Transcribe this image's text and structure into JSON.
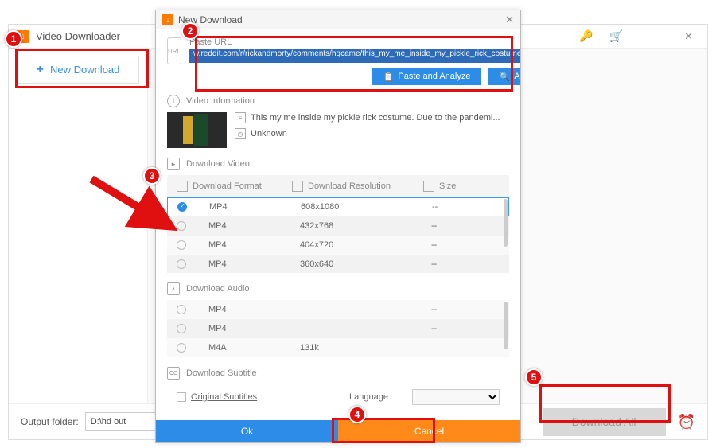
{
  "main": {
    "title": "Video Downloader",
    "newDownload": "New Download",
    "outputFolderLabel": "Output folder:",
    "outputFolderValue": "D:\\hd out",
    "downloadAll": "Download All"
  },
  "dialog": {
    "title": "New Download",
    "pasteUrlLabel": "Paste URL",
    "urlValue": "w.reddit.com/r/rickandmorty/comments/hqcame/this_my_me_inside_my_pickle_rick_costume_due_to/",
    "pasteAnalyze": "Paste and Analyze",
    "analyze": "Analyze",
    "videoInfoHdr": "Video Information",
    "videoTitle": "This my me inside my pickle rick costume. Due to the pandemi...",
    "videoDuration": "Unknown",
    "downloadVideoHdr": "Download Video",
    "cols": {
      "format": "Download Format",
      "resolution": "Download Resolution",
      "size": "Size"
    },
    "videoRows": [
      {
        "fmt": "MP4",
        "res": "608x1080",
        "sz": "--",
        "sel": true
      },
      {
        "fmt": "MP4",
        "res": "432x768",
        "sz": "--",
        "sel": false
      },
      {
        "fmt": "MP4",
        "res": "404x720",
        "sz": "--",
        "sel": false
      },
      {
        "fmt": "MP4",
        "res": "360x640",
        "sz": "--",
        "sel": false
      }
    ],
    "downloadAudioHdr": "Download Audio",
    "audioRows": [
      {
        "fmt": "MP4",
        "res": "",
        "sz": "--",
        "sel": false
      },
      {
        "fmt": "MP4",
        "res": "",
        "sz": "--",
        "sel": false
      },
      {
        "fmt": "M4A",
        "res": "131k",
        "sz": "",
        "sel": false
      }
    ],
    "downloadSubHdr": "Download Subtitle",
    "origSub": "Original Subtitles",
    "language": "Language",
    "ok": "Ok",
    "cancel": "Cancel"
  },
  "callouts": [
    "1",
    "2",
    "3",
    "4",
    "5"
  ]
}
